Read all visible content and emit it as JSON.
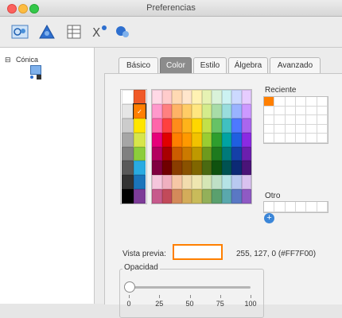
{
  "window": {
    "title": "Preferencias"
  },
  "toolbar": {
    "icons": [
      "graphics-icon",
      "geometry-icon",
      "spreadsheet-icon",
      "cas-icon",
      "defaults-icon"
    ]
  },
  "sidebar": {
    "root_label": "Cónica"
  },
  "tabs": [
    "Básico",
    "Color",
    "Estilo",
    "Álgebra",
    "Avanzado"
  ],
  "active_tab": "Color",
  "palette": {
    "grays": [
      "#ffffff",
      "#e6e6e6",
      "#cccccc",
      "#a6a6a6",
      "#808080",
      "#595959",
      "#333333",
      "#000000"
    ],
    "accent_column": [
      "#f05a28",
      "#ff7f00",
      "#ffe600",
      "#d7e64b",
      "#8ccd3b",
      "#29abe2",
      "#1b75bb",
      "#7d3c98"
    ],
    "grid_rows": [
      [
        "#ffd9e6",
        "#ffcccc",
        "#ffd9b3",
        "#ffe6cc",
        "#fff2b3",
        "#e6f2b3",
        "#d9f2d9",
        "#ccf2f2",
        "#ccd9ff",
        "#e6ccff"
      ],
      [
        "#ff99cc",
        "#ff8080",
        "#ffb366",
        "#ffcc66",
        "#ffe680",
        "#d4ec8c",
        "#a8dca8",
        "#99dddd",
        "#99b3ff",
        "#cc99ff"
      ],
      [
        "#ff66aa",
        "#ff4040",
        "#ff8c1a",
        "#ffb31a",
        "#ffd700",
        "#c2e04a",
        "#66c266",
        "#40c0c0",
        "#4d79ff",
        "#aa66ee"
      ],
      [
        "#e6007a",
        "#e00000",
        "#ff7f00",
        "#ff9900",
        "#f2c200",
        "#9acd32",
        "#2e9e2e",
        "#00a3a3",
        "#1f5fe0",
        "#8a2be2"
      ],
      [
        "#b3005f",
        "#a80000",
        "#cc5c00",
        "#cc7a00",
        "#bf9900",
        "#6e9a1e",
        "#1e7a1e",
        "#007a7a",
        "#1440a8",
        "#6b1fae"
      ],
      [
        "#800040",
        "#700000",
        "#8a3d00",
        "#8a5200",
        "#806600",
        "#4a6a12",
        "#0f520f",
        "#005252",
        "#0c2a75",
        "#4a1478"
      ],
      [
        "#f5c6dc",
        "#f0b0c0",
        "#f6c7a6",
        "#f2dcae",
        "#efe6b0",
        "#d5e6b5",
        "#bfe0c6",
        "#b5e3e6",
        "#b9c9f0",
        "#d9c2ef"
      ],
      [
        "#c75a8c",
        "#c24a5a",
        "#d48a5a",
        "#d4ac5a",
        "#c9bb5a",
        "#93b05a",
        "#5aa06e",
        "#5aa8ad",
        "#5a78c4",
        "#8f5ac4"
      ]
    ]
  },
  "recent": {
    "label": "Reciente",
    "colors": [
      "#ff7f00"
    ]
  },
  "other": {
    "label": "Otro"
  },
  "preview": {
    "label": "Vista previa:",
    "color": "#ff7f00",
    "rgb_text": "255, 127, 0 (#FF7F00)"
  },
  "opacity": {
    "label": "Opacidad",
    "value": 0,
    "ticks": [
      "0",
      "25",
      "50",
      "75",
      "100"
    ]
  }
}
